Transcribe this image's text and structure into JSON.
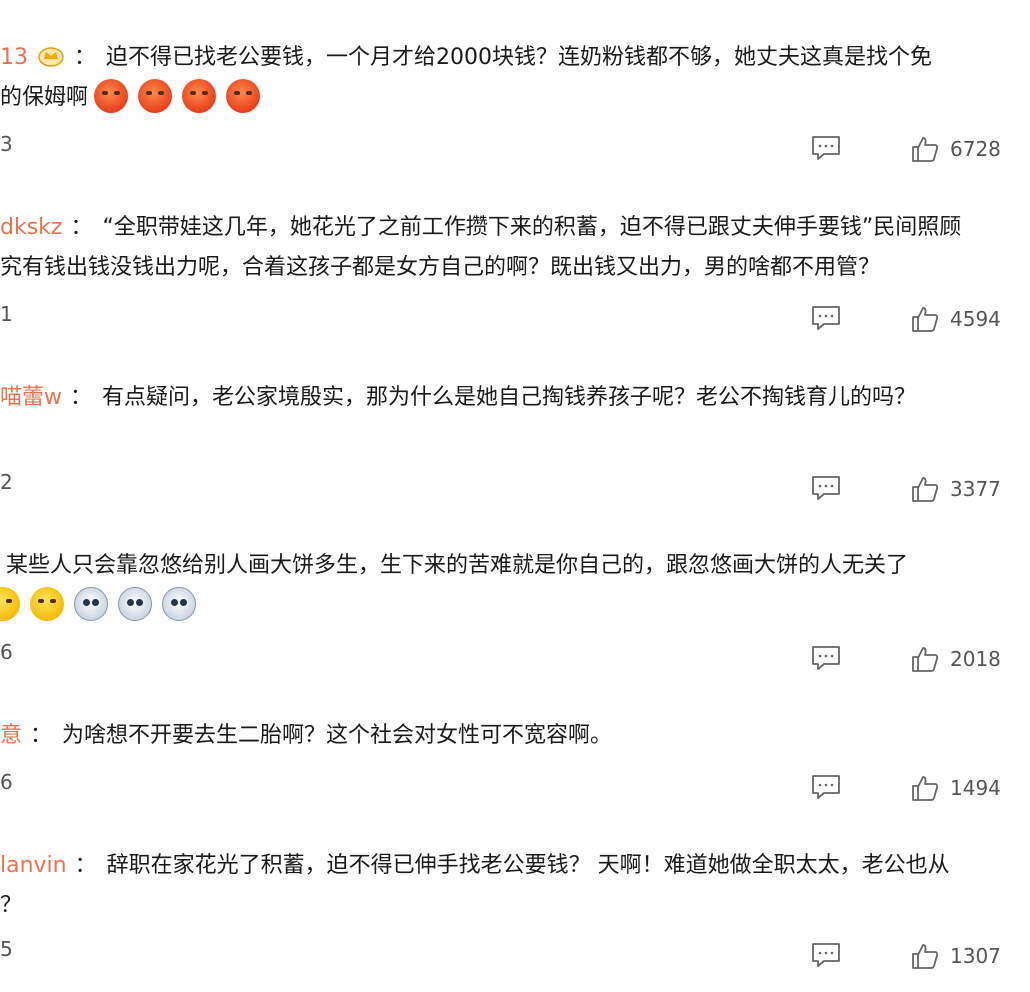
{
  "comments": [
    {
      "user": "13",
      "separator": "：",
      "line1": "迫不得已找老公要钱，一个月才给2000块钱？连奶粉钱都不够，她丈夫这真是找个免",
      "line2": "的保姆啊",
      "emojis": [
        "angry-emoji",
        "angry-emoji",
        "angry-emoji",
        "angry-emoji"
      ],
      "left_number": "3",
      "like_count": "6728"
    },
    {
      "user": "dkskz",
      "separator": "：",
      "line1": "“全职带娃这几年，她花光了之前工作攒下来的积蓄，迫不得已跟丈夫伸手要钱”民间照顾",
      "line2": "究有钱出钱没钱出力呢，合着这孩子都是女方自己的啊？既出钱又出力，男的啥都不用管？",
      "left_number": "1",
      "like_count": "4594"
    },
    {
      "user": "喵蕾w",
      "separator": "：",
      "line1": "有点疑问，老公家境殷实，那为什么是她自己掏钱养孩子呢？老公不掏钱育儿的吗？",
      "left_number": "2",
      "like_count": "3377"
    },
    {
      "user": "",
      "separator": "",
      "line1": "某些人只会靠忽悠给别人画大饼多生，生下来的苦难就是你自己的，跟忽悠画大饼的人无关了",
      "emojis": [
        "smile-emoji",
        "smile-emoji",
        "dog-emoji",
        "dog-emoji",
        "dog-emoji"
      ],
      "left_number": "6",
      "like_count": "2018"
    },
    {
      "user": "意",
      "separator": "：",
      "line1": "为啥想不开要去生二胎啊？这个社会对女性可不宽容啊。",
      "left_number": "6",
      "like_count": "1494"
    },
    {
      "user": "lanvin",
      "separator": "：",
      "line1": "辞职在家花光了积蓄，迫不得已伸手找老公要钱？ 天啊！难道她做全职太太，老公也从",
      "line2": "？",
      "left_number": "5",
      "like_count": "1307"
    }
  ],
  "icons": {
    "reply": "comment-icon",
    "like": "thumbs-up-icon",
    "badge": "crown-badge-icon"
  },
  "colors": {
    "username": "#eb7350",
    "text": "#1a1a1a",
    "meta": "#555555"
  }
}
